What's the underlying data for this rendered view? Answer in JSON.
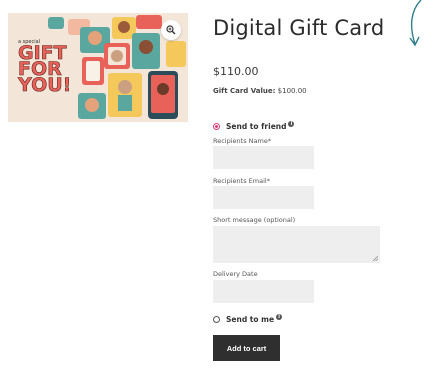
{
  "product": {
    "title": "Digital Gift Card",
    "price": "$110.00",
    "value_label": "Gift Card Value:",
    "value_amount": "$100.00",
    "image_text": {
      "small": "a special",
      "line1": "GIFT",
      "line2": "FOR",
      "line3": "YOU!"
    }
  },
  "form": {
    "send_to_friend_label": "Send to friend",
    "recipients_name_label": "Recipients Name*",
    "recipients_email_label": "Recipients Email*",
    "short_message_label": "Short message (optional)",
    "delivery_date_label": "Delivery Date",
    "send_to_me_label": "Send to me",
    "info_glyph": "i",
    "selected_option": "send_to_friend",
    "recipients_name_value": "",
    "recipients_email_value": "",
    "short_message_value": "",
    "delivery_date_value": ""
  },
  "actions": {
    "add_to_cart_label": "Add to cart"
  },
  "icons": {
    "zoom": "zoom-icon",
    "info": "info-icon",
    "resize": "resize-grip-icon",
    "arrow": "curved-arrow-icon"
  },
  "colors": {
    "accent_radio": "#d63f7a",
    "button_bg": "#2f2f2f",
    "field_bg": "#eeeeee",
    "gift_text": "#e8625a",
    "corner_arrow": "#2f7f8a"
  }
}
